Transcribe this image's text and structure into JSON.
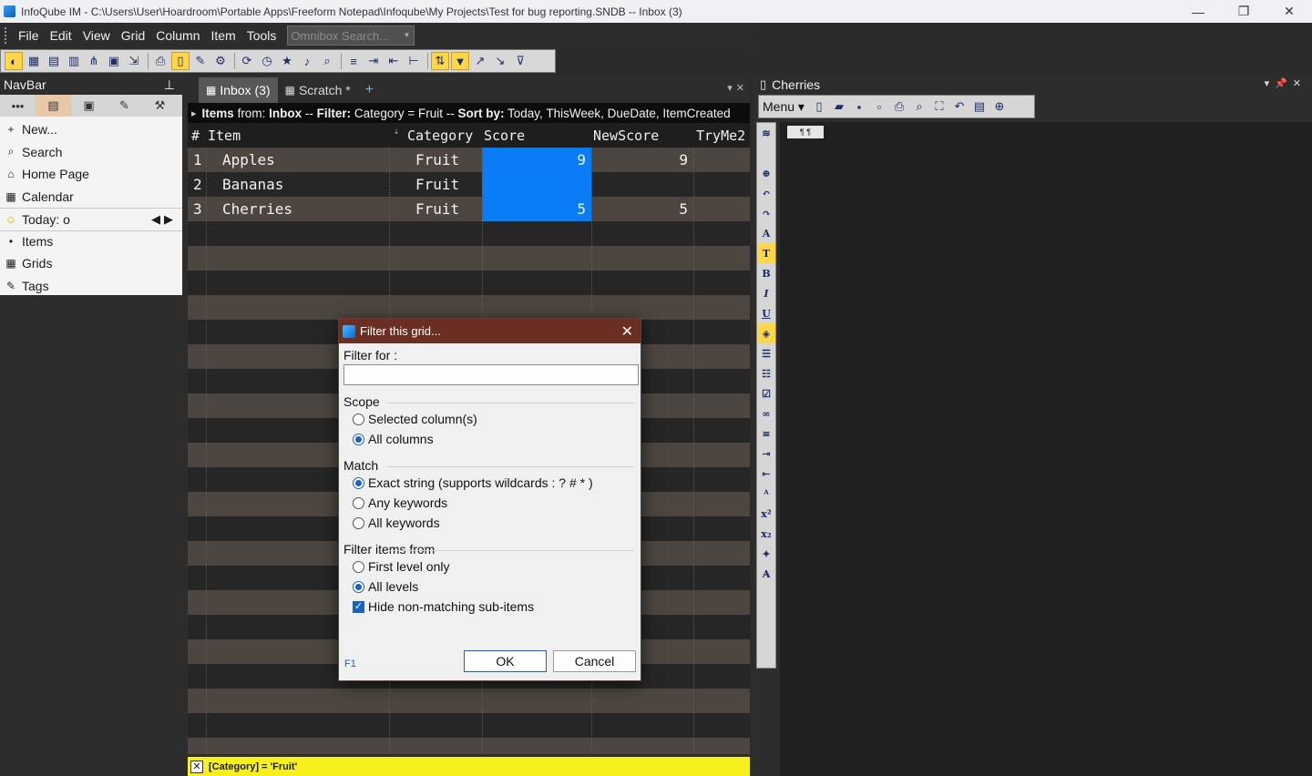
{
  "window": {
    "title": "InfoQube IM - C:\\Users\\User\\Hoardroom\\Portable Apps\\Freeform Notepad\\Infoqube\\My Projects\\Test for bug reporting.SNDB -- Inbox (3)",
    "minimize": "—",
    "maximize": "❐",
    "close": "✕"
  },
  "menu": {
    "items": [
      "File",
      "Edit",
      "View",
      "Grid",
      "Column",
      "Item",
      "Tools"
    ],
    "omnibox_placeholder": "Omnibox Search..."
  },
  "navbar": {
    "title": "NavBar",
    "pin": "📌",
    "tab_icons": [
      "⋯",
      "📄",
      "🗂",
      "🏷",
      "🛠"
    ],
    "items": [
      {
        "icon": "+",
        "label": "New..."
      },
      {
        "icon": "🔍",
        "label": "Search"
      },
      {
        "icon": "🏠",
        "label": "Home Page"
      },
      {
        "icon": "📅",
        "label": "Calendar"
      },
      {
        "icon": "🙂",
        "label": "Today: o"
      },
      {
        "icon": "•",
        "label": "Items"
      },
      {
        "icon": "▦",
        "label": "Grids"
      },
      {
        "icon": "🏷",
        "label": "Tags"
      }
    ],
    "today_arrows": "◀▶"
  },
  "tabs": {
    "items": [
      {
        "label": "Inbox (3)",
        "active": true
      },
      {
        "label": "Scratch *",
        "active": false
      }
    ],
    "add": "+",
    "controls": "▾✕"
  },
  "filter_info": {
    "items_from_label": "Items",
    "from_text": " from: ",
    "source": "Inbox",
    "sep1": " -- ",
    "filter_label": "Filter:",
    "filter_value": " Category = Fruit ",
    "sep2": "-- ",
    "sort_label": "Sort by:",
    "sort_value": " Today, ThisWeek, DueDate, ItemCreated"
  },
  "grid": {
    "columns": [
      "#",
      "Item",
      "Category",
      "Score",
      "NewScore",
      "TryMe2"
    ],
    "rows": [
      {
        "num": "1",
        "item": "Apples",
        "category": "Fruit",
        "score": "9",
        "newscore": "9"
      },
      {
        "num": "2",
        "item": "Bananas",
        "category": "Fruit",
        "score": "",
        "newscore": ""
      },
      {
        "num": "3",
        "item": "Cherries",
        "category": "Fruit",
        "score": "5",
        "newscore": "5"
      }
    ]
  },
  "statusbar": {
    "close": "✕",
    "text": "[Category] = 'Fruit'"
  },
  "right_panel": {
    "title": "Cherries",
    "controls": "▾📌✕",
    "menu_label": "Menu",
    "mini_label": "¶ ¶"
  },
  "dialog": {
    "title": "Filter this grid...",
    "close": "✕",
    "filter_for_label": "Filter for :",
    "filter_value": "",
    "scope": {
      "title": "Scope",
      "options": [
        "Selected column(s)",
        "All columns"
      ],
      "selected": 1
    },
    "match": {
      "title": "Match",
      "options": [
        "Exact string (supports wildcards : ? # * )",
        "Any keywords",
        "All keywords"
      ],
      "selected": 0
    },
    "filter_from": {
      "title": "Filter items from",
      "options": [
        "First level only",
        "All levels"
      ],
      "selected": 1
    },
    "hide_nonmatching": {
      "label": "Hide non-matching sub-items",
      "checked": true
    },
    "help": "F1",
    "ok": "OK",
    "cancel": "Cancel"
  }
}
